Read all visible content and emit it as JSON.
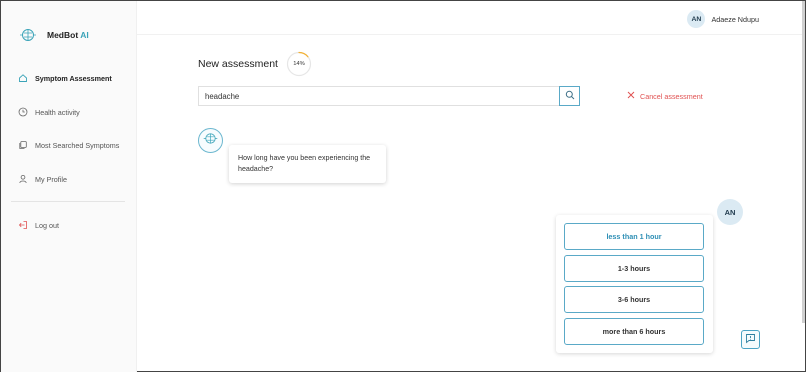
{
  "brand": {
    "name": "MedBot",
    "ai": "AI",
    "logo_icon": "brain-icon"
  },
  "sidebar": {
    "items": [
      {
        "label": "Symptom Assessment",
        "icon": "home-icon",
        "active": true
      },
      {
        "label": "Health activity",
        "icon": "clock-icon",
        "active": false
      },
      {
        "label": "Most Searched Symptoms",
        "icon": "copy-icon",
        "active": false
      },
      {
        "label": "My Profile",
        "icon": "user-icon",
        "active": false
      }
    ],
    "logout_label": "Log out"
  },
  "header": {
    "user_initials": "AN",
    "user_name": "Adaeze Ndupu"
  },
  "assessment": {
    "title": "New assessment",
    "progress_label": "14%",
    "progress_percent": 14,
    "search_value": "headache",
    "cancel_label": "Cancel assessment"
  },
  "chat": {
    "bot_question": "How long have you been experiencing the headache?",
    "user_initials": "AN",
    "options": [
      "less than 1 hour",
      "1-3 hours",
      "3-6 hours",
      "more than 6 hours"
    ]
  },
  "colors": {
    "accent": "#5aa9c7",
    "danger": "#e05252",
    "progress": "#f2b134"
  }
}
